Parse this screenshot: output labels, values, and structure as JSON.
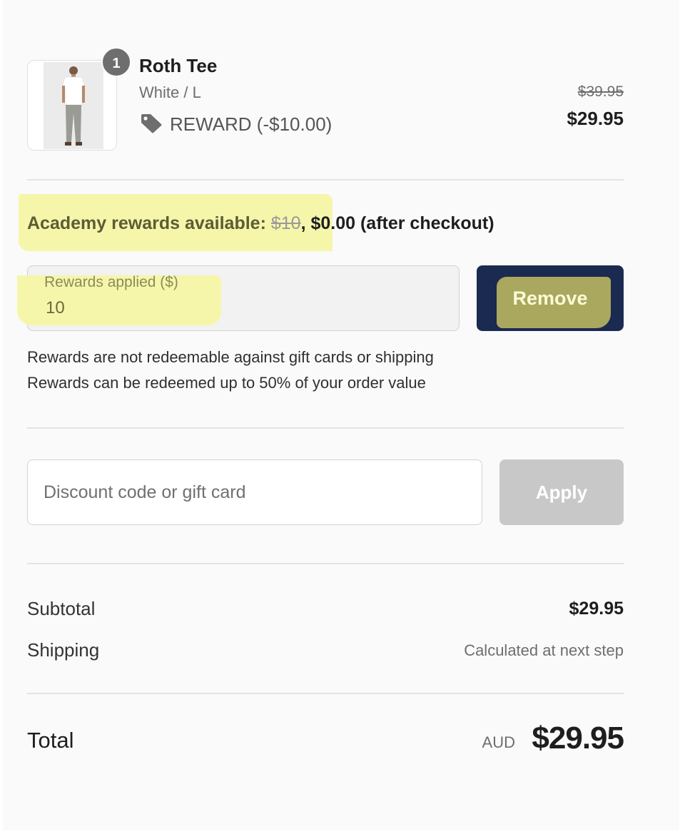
{
  "cart": {
    "item": {
      "quantity": "1",
      "name": "Roth Tee",
      "variant": "White / L",
      "discount_label": "REWARD (-$10.00)",
      "original_price": "$39.95",
      "price": "$29.95",
      "tag_icon": "tag-icon"
    }
  },
  "rewards": {
    "available_label": "Academy rewards available: ",
    "available_original": "$10",
    "available_after": ", $0.00 (after checkout)",
    "applied_label": "Rewards applied ($)",
    "applied_value": "10",
    "remove_label": "Remove",
    "notes": [
      "Rewards are not redeemable against gift cards or shipping",
      "Rewards can be redeemed up to 50% of your order value"
    ]
  },
  "discount": {
    "placeholder": "Discount code or gift card",
    "value": "",
    "apply_label": "Apply"
  },
  "summary": {
    "subtotal_label": "Subtotal",
    "subtotal_value": "$29.95",
    "shipping_label": "Shipping",
    "shipping_value": "Calculated at next step",
    "total_label": "Total",
    "currency": "AUD",
    "total_value": "$29.95"
  },
  "colors": {
    "primary_button": "#1b2a50",
    "disabled_button": "#c8c8c8",
    "highlight": "#f6f6a6"
  }
}
